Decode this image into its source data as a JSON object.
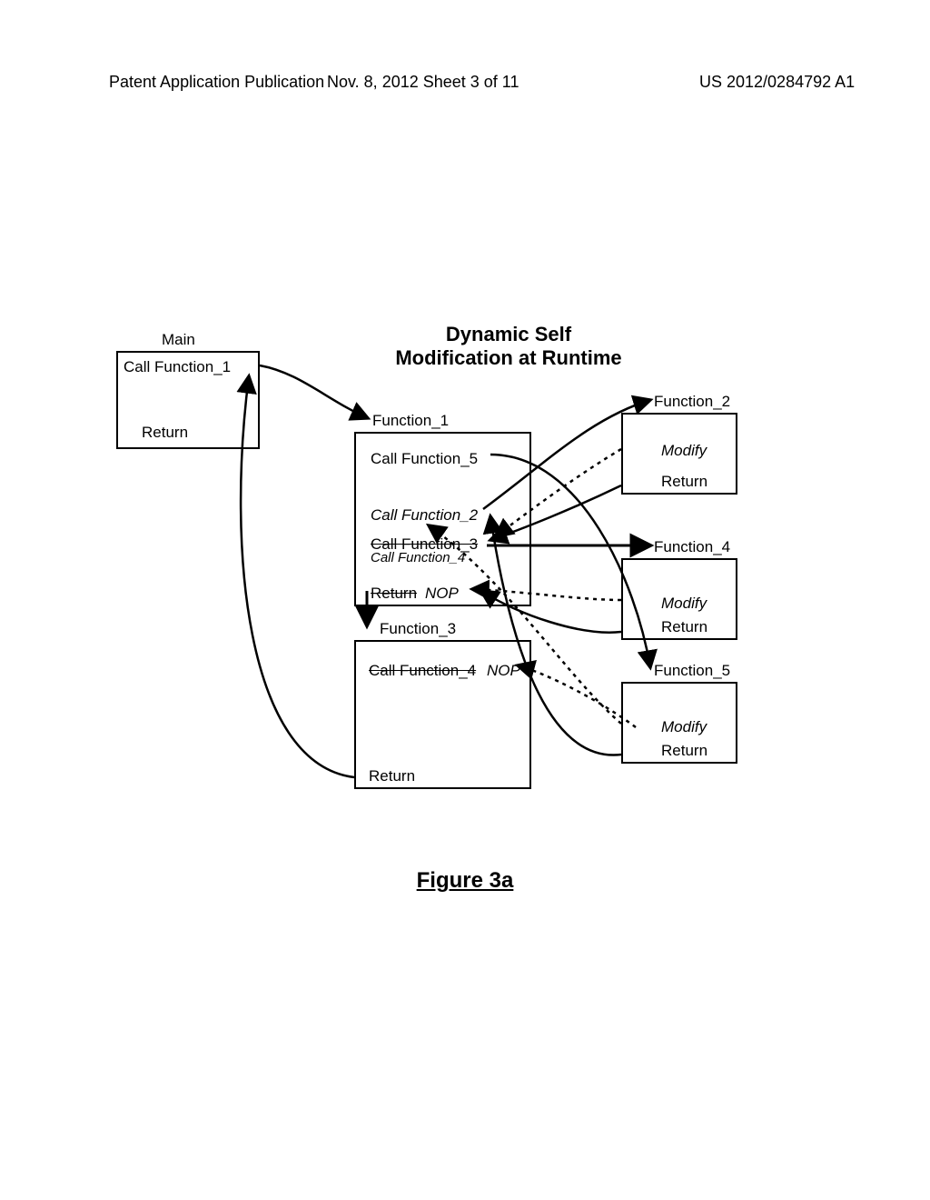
{
  "header": {
    "left": "Patent Application Publication",
    "center": "Nov. 8, 2012  Sheet 3 of 11",
    "right": "US 2012/0284792 A1"
  },
  "diagram": {
    "title_line1": "Dynamic Self",
    "title_line2": "Modification at Runtime",
    "main": {
      "name": "Main",
      "call": "Call Function_1",
      "return": "Return"
    },
    "f1": {
      "name": "Function_1",
      "call5": "Call Function_5",
      "call2": "Call Function_2",
      "call3": "Call Function_3",
      "call4": "Call Function_4",
      "return": "Return",
      "nop": "NOP"
    },
    "f3": {
      "name": "Function_3",
      "call4": "Call Function_4",
      "nop": "NOP",
      "return": "Return"
    },
    "f2": {
      "name": "Function_2",
      "modify": "Modify",
      "return": "Return"
    },
    "f4": {
      "name": "Function_4",
      "modify": "Modify",
      "return": "Return"
    },
    "f5": {
      "name": "Function_5",
      "modify": "Modify",
      "return": "Return"
    }
  },
  "figure_caption": "Figure 3a"
}
